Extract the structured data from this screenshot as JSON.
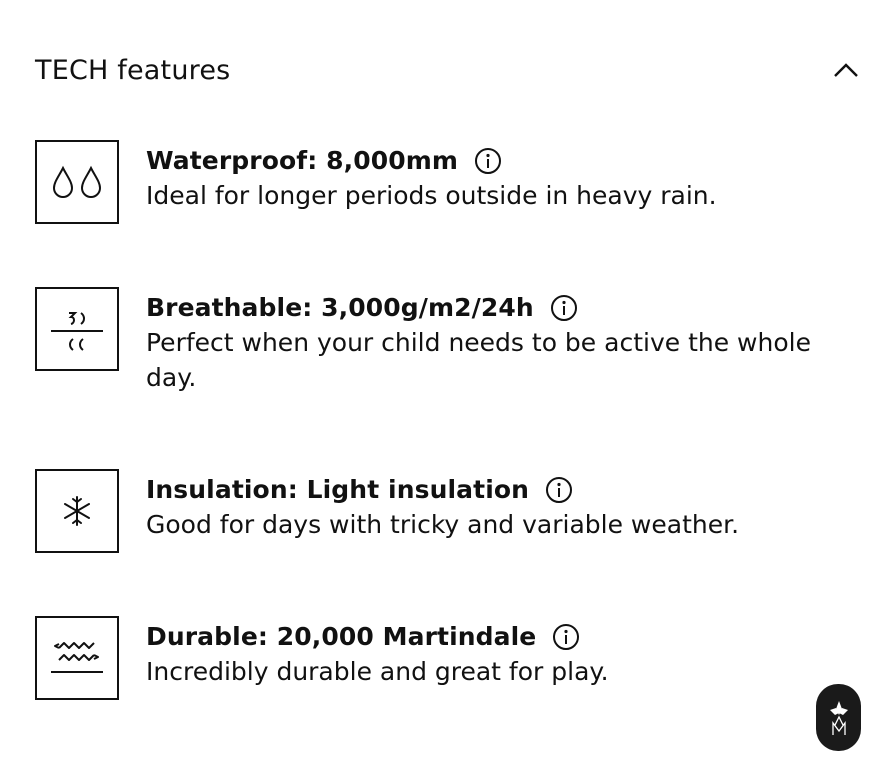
{
  "section": {
    "title": "TECH features",
    "toggle_icon": "chevron-up-icon"
  },
  "features": [
    {
      "icon": "water-drops-icon",
      "title": "Waterproof: 8,000mm",
      "description": "Ideal for longer periods outside in heavy rain."
    },
    {
      "icon": "breathable-icon",
      "title": "Breathable: 3,000g/m2/24h",
      "description": "Perfect when your child needs to be active the whole day."
    },
    {
      "icon": "snowflake-icon",
      "title": "Insulation: Light insulation",
      "description": "Good for days with tricky and variable weather."
    },
    {
      "icon": "durable-icon",
      "title": "Durable: 20,000 Martindale",
      "description": "Incredibly durable and great for play."
    }
  ],
  "brand_badge": {
    "icon": "brand-logo-icon"
  }
}
